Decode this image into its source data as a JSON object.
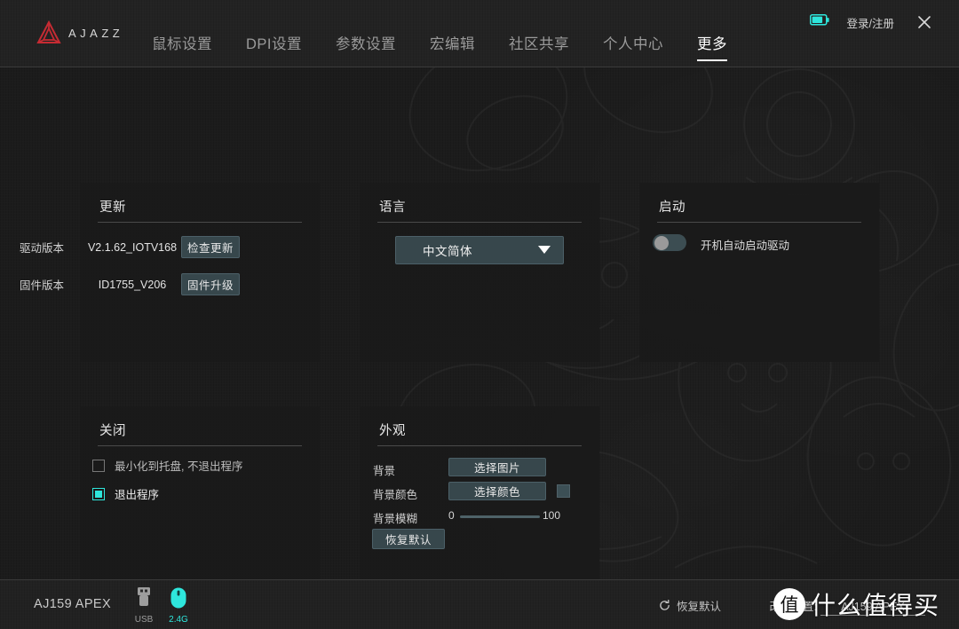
{
  "header": {
    "logo_text": "AJAZZ",
    "logo_icon": "ajazz-triangle-logo",
    "battery_icon": "battery-icon",
    "login_label": "登录/注册",
    "close_icon": "close-icon",
    "nav": [
      {
        "label": "鼠标设置",
        "active": false
      },
      {
        "label": "DPI设置",
        "active": false
      },
      {
        "label": "参数设置",
        "active": false
      },
      {
        "label": "宏编辑",
        "active": false
      },
      {
        "label": "社区共享",
        "active": false
      },
      {
        "label": "个人中心",
        "active": false
      },
      {
        "label": "更多",
        "active": true
      }
    ]
  },
  "panels": {
    "update": {
      "title": "更新",
      "rows": [
        {
          "label": "驱动版本",
          "value": "V2.1.62_IOTV168",
          "button": "检查更新"
        },
        {
          "label": "固件版本",
          "value": "ID1755_V206",
          "button": "固件升级"
        }
      ]
    },
    "language": {
      "title": "语言",
      "selected": "中文简体",
      "caret_icon": "chevron-down-icon"
    },
    "startup": {
      "title": "启动",
      "toggle_label": "开机自动启动驱动",
      "toggle_state": "off"
    },
    "close": {
      "title": "关闭",
      "options": [
        {
          "label": "最小化到托盘, 不退出程序",
          "checked": false
        },
        {
          "label": "退出程序",
          "checked": true
        }
      ]
    },
    "appearance": {
      "title": "外观",
      "background_label": "背景",
      "background_button": "选择图片",
      "background_color_label": "背景颜色",
      "background_color_button": "选择颜色",
      "background_color_swatch": "#3c4f55",
      "blur_label": "背景模糊",
      "blur_min": "0",
      "blur_max": "100",
      "reset_button": "恢复默认"
    }
  },
  "footer": {
    "device_name": "AJ159 APEX",
    "connections": [
      {
        "icon": "usb-icon",
        "label": "USB",
        "active": false
      },
      {
        "icon": "mouse-icon",
        "label": "2.4G",
        "active": true
      }
    ],
    "restore_icon": "refresh-icon",
    "restore_label": "恢复默认",
    "profile_label": "改键配置:",
    "profile_value": "AJ159 APEX"
  },
  "watermark": {
    "badge": "值",
    "text": "什么值得买"
  },
  "colors": {
    "accent_cyan": "#2ee6dc",
    "brand_red": "#c62b33",
    "button_bg": "#37474c",
    "panel_bg": "#1a1a1a",
    "chrome_bg": "#232323"
  }
}
